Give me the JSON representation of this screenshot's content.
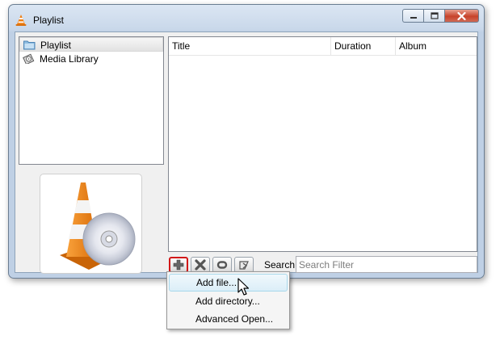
{
  "window": {
    "title": "Playlist"
  },
  "sidebar": {
    "items": [
      {
        "label": "Playlist",
        "icon": "folder-icon",
        "selected": true
      },
      {
        "label": "Media Library",
        "icon": "media-library-icon",
        "selected": false
      }
    ]
  },
  "playlist": {
    "columns": [
      "Title",
      "Duration",
      "Album"
    ]
  },
  "toolbar": {
    "buttons": [
      "add-icon",
      "remove-icon",
      "repeat-icon",
      "eject-icon"
    ],
    "search_label": "Search",
    "search_placeholder": "Search Filter",
    "search_value": ""
  },
  "menu": {
    "items": [
      {
        "label": "Add file...",
        "highlighted": true
      },
      {
        "label": "Add directory...",
        "highlighted": false
      },
      {
        "label": "Advanced Open...",
        "highlighted": false
      }
    ]
  },
  "colors": {
    "accent_highlight": "#d21818",
    "cone_orange": "#f07f12",
    "close_button": "#c7432b"
  }
}
